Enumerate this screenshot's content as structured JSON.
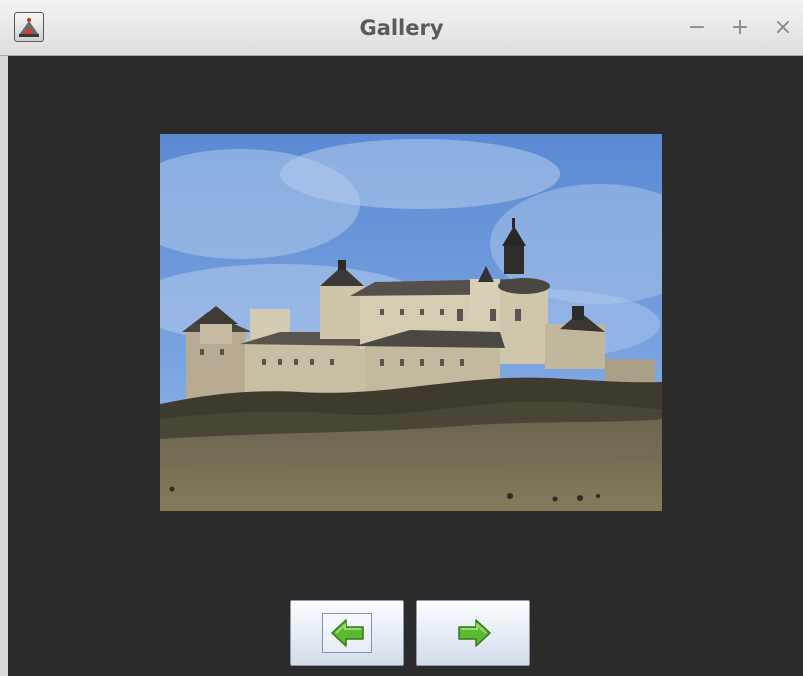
{
  "window": {
    "title": "Gallery",
    "minimize_glyph": "−",
    "maximize_glyph": "+",
    "close_glyph": "×",
    "app_icon": "java-app-icon"
  },
  "gallery": {
    "image_subject": "castle-photo",
    "prev_icon": "green-left-arrow-icon",
    "next_icon": "green-right-arrow-icon",
    "focused_button": "previous"
  },
  "colors": {
    "content_background": "#2b2b2b",
    "titlebar_text": "#5a5a5a",
    "arrow_green": "#5db832"
  }
}
